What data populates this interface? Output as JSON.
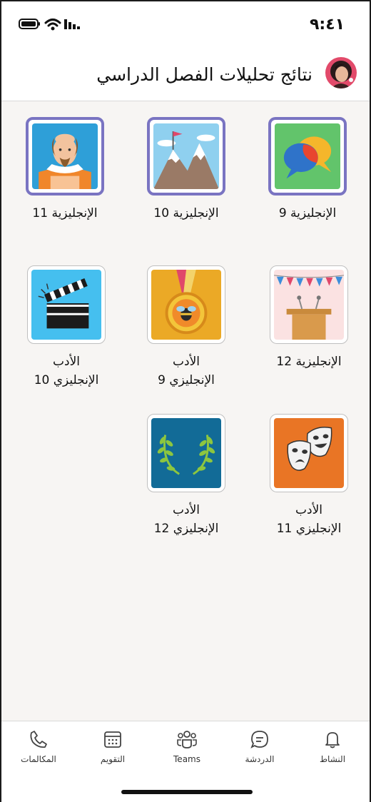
{
  "status_bar": {
    "time": "٩:٤١"
  },
  "header": {
    "title": "نتائج تحليلات الفصل الدراسي"
  },
  "classes": [
    {
      "label_line1": "الإنجليزية 9",
      "label_line2": "",
      "art": "chat-bubbles-art"
    },
    {
      "label_line1": "الإنجليزية 10",
      "label_line2": "",
      "art": "mountain-flag-art"
    },
    {
      "label_line1": "الإنجليزية 11",
      "label_line2": "",
      "art": "shakespeare-art"
    },
    {
      "label_line1": "الإنجليزية 12",
      "label_line2": "",
      "art": "podium-art"
    },
    {
      "label_line1": "الأدب",
      "label_line2": "الإنجليزي 9",
      "art": "medal-art"
    },
    {
      "label_line1": "الأدب",
      "label_line2": "الإنجليزي 10",
      "art": "clapperboard-art"
    },
    {
      "label_line1": "الأدب",
      "label_line2": "الإنجليزي 11",
      "art": "theater-masks-art"
    },
    {
      "label_line1": "الأدب",
      "label_line2": "الإنجليزي 12",
      "art": "laurel-art"
    }
  ],
  "tabbar": {
    "activity": "النشاط",
    "chat": "الدردشة",
    "teams": "Teams",
    "calendar": "التقويم",
    "calls": "المكالمات"
  },
  "colors": {
    "selected_border": "#7a74c2",
    "background": "#f7f5f3"
  }
}
